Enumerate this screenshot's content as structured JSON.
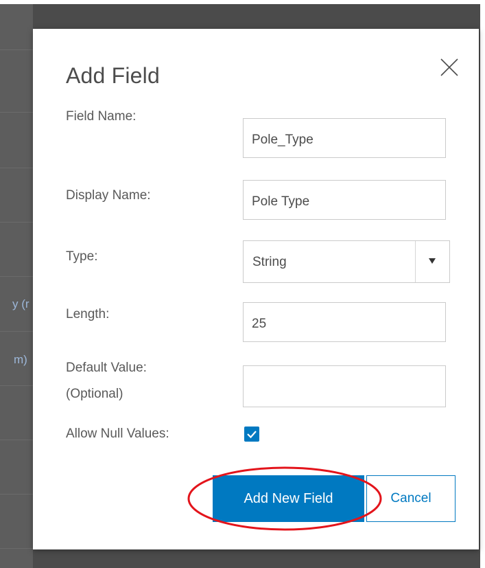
{
  "background": {
    "fragments": [
      "y (r",
      "m)"
    ]
  },
  "dialog": {
    "title": "Add Field",
    "close_icon": "close-icon",
    "fields": {
      "field_name": {
        "label": "Field Name:",
        "value": "Pole_Type"
      },
      "display_name": {
        "label": "Display Name:",
        "value": "Pole Type"
      },
      "type": {
        "label": "Type:",
        "selected": "String",
        "icon": "triangle-down-icon"
      },
      "length": {
        "label": "Length:",
        "value": "25"
      },
      "default_value": {
        "label_line1": "Default Value:",
        "label_line2": "(Optional)",
        "value": ""
      },
      "allow_null": {
        "label": "Allow Null Values:",
        "checked": true
      }
    },
    "buttons": {
      "add_new_field": "Add New Field",
      "cancel": "Cancel"
    }
  },
  "annotation": {
    "type": "red-ellipse-highlight",
    "color": "#e3141b"
  },
  "colors": {
    "accent": "#0079c1",
    "overlay": "#4b4b4b",
    "text": "#595959",
    "border": "#cacaca"
  }
}
